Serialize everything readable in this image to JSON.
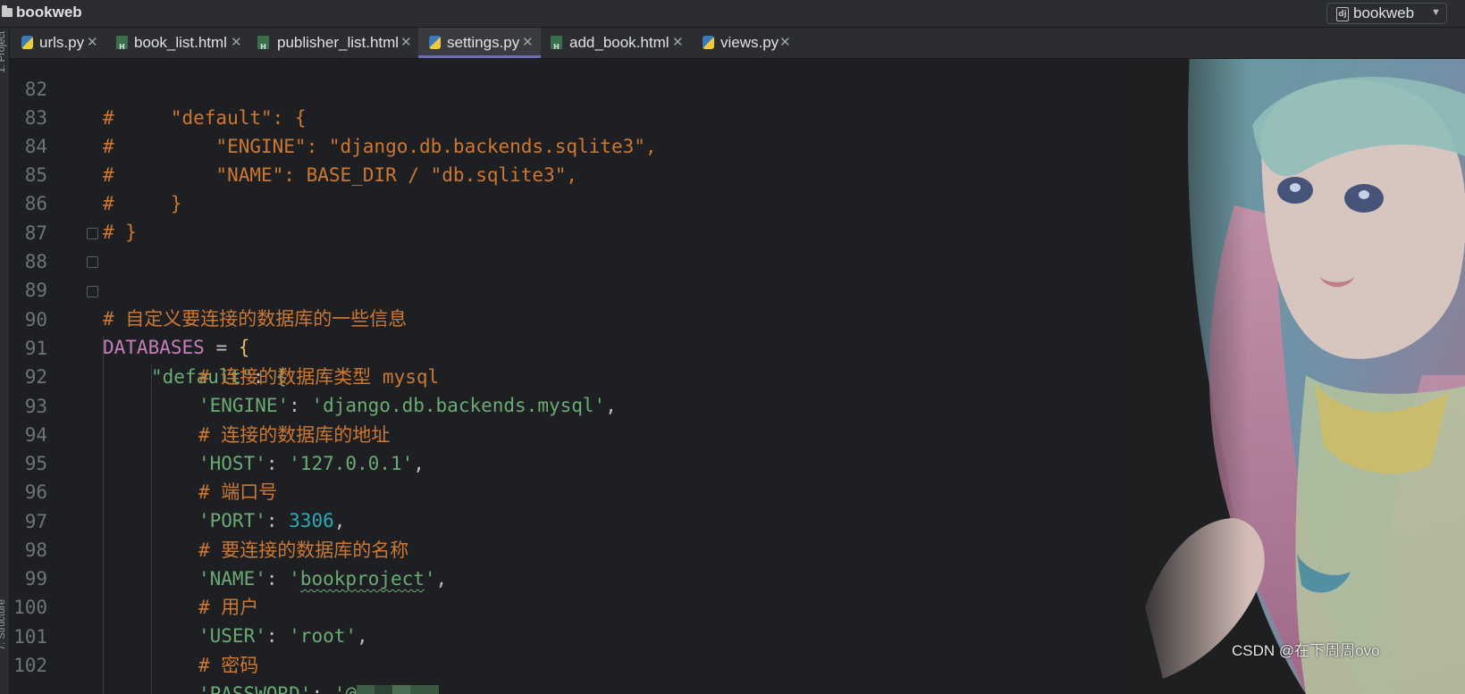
{
  "window": {
    "project_name": "bookweb",
    "run_config": "bookweb"
  },
  "tabs": [
    {
      "label": "urls.py",
      "type": "py"
    },
    {
      "label": "book_list.html",
      "type": "html"
    },
    {
      "label": "publisher_list.html",
      "type": "html"
    },
    {
      "label": "settings.py",
      "type": "py",
      "active": true
    },
    {
      "label": "add_book.html",
      "type": "html"
    },
    {
      "label": "views.py",
      "type": "py"
    }
  ],
  "side_labels": {
    "project": "1: Project",
    "structure": "7: Structure"
  },
  "code": {
    "line_numbers": [
      "82",
      "83",
      "84",
      "85",
      "86",
      "87",
      "88",
      "89",
      "90",
      "91",
      "92",
      "93",
      "94",
      "95",
      "96",
      "97",
      "98",
      "99",
      "100",
      "101",
      "102"
    ],
    "l82": "#     \"default\": {",
    "l83": "#         \"ENGINE\": \"django.db.backends.sqlite3\",",
    "l84": "#         \"NAME\": BASE_DIR / \"db.sqlite3\",",
    "l85": "#     }",
    "l86": "# }",
    "l88": "# 自定义要连接的数据库的一些信息",
    "l89_ident": "DATABASES",
    "l89_op": " = ",
    "l89_brace": "{",
    "l90_key": "\"default\"",
    "l90_colon": ": ",
    "l90_brace": "{",
    "l91": "# 连接的数据库类型 mysql",
    "l92_key": "'ENGINE'",
    "l92_val": "'django.db.backends.mysql'",
    "l93": "# 连接的数据库的地址",
    "l94_key": "'HOST'",
    "l94_val": "'127.0.0.1'",
    "l95": "# 端口号",
    "l96_key": "'PORT'",
    "l96_val": "3306",
    "l97": "# 要连接的数据库的名称",
    "l98_key": "'NAME'",
    "l98_q": "'",
    "l98_word": "bookproject",
    "l99": "# 用户",
    "l100_key": "'USER'",
    "l100_val": "'root'",
    "l101": "# 密码",
    "l102_key": "'PASSWORD'",
    "l102_val": "'@"
  },
  "watermark": "CSDN @在下周周ovo",
  "colors": {
    "comment": "#cc7832",
    "string": "#6aab73",
    "identifier": "#c77dbb",
    "accent": "#6e6bbd"
  }
}
